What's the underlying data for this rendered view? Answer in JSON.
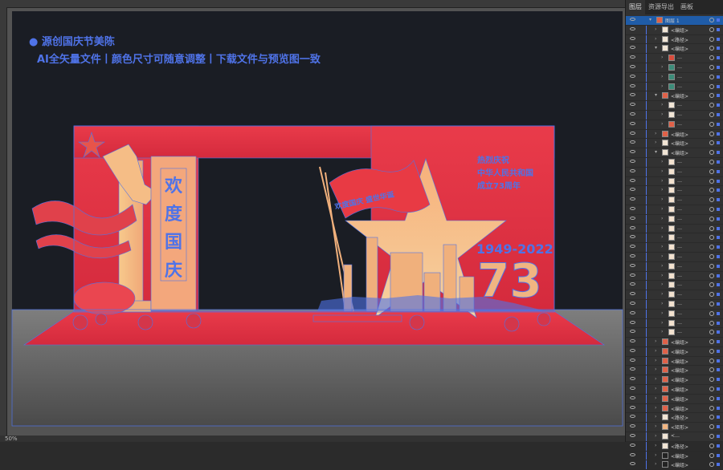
{
  "panel": {
    "tabs": [
      "图层",
      "资源导出",
      "画板"
    ],
    "top_layer": "图层 1",
    "rows": [
      {
        "indent": 1,
        "label": "<编组>",
        "thumb": "#f1e5d5"
      },
      {
        "indent": 1,
        "label": "<路径>",
        "thumb": "#f1e5d5"
      },
      {
        "indent": 1,
        "label": "<编组>",
        "thumb": "#f1e5d5",
        "open": true
      },
      {
        "indent": 2,
        "label": "…",
        "thumb": "#d94c3c"
      },
      {
        "indent": 2,
        "label": "…",
        "thumb": "#3c8c79"
      },
      {
        "indent": 2,
        "label": "…",
        "thumb": "#3c8c79"
      },
      {
        "indent": 2,
        "label": "…",
        "thumb": "#3c8c79"
      },
      {
        "indent": 1,
        "label": "<编组>",
        "thumb": "#e06148",
        "open": true
      },
      {
        "indent": 2,
        "label": "…",
        "thumb": "#f1e5d5"
      },
      {
        "indent": 2,
        "label": "…",
        "thumb": "#f1e5d5"
      },
      {
        "indent": 2,
        "label": "…",
        "thumb": "#e06148"
      },
      {
        "indent": 1,
        "label": "<编组>",
        "thumb": "#e06148"
      },
      {
        "indent": 1,
        "label": "<编组>",
        "thumb": "#f1e5d5"
      },
      {
        "indent": 1,
        "label": "<编组>",
        "thumb": "#f1e5d5",
        "open": true
      },
      {
        "indent": 2,
        "label": "…",
        "thumb": "#f3e2cf"
      },
      {
        "indent": 2,
        "label": "…",
        "thumb": "#f3e2cf"
      },
      {
        "indent": 2,
        "label": "…",
        "thumb": "#f3e2cf"
      },
      {
        "indent": 2,
        "label": "…",
        "thumb": "#f3e2cf"
      },
      {
        "indent": 2,
        "label": "…",
        "thumb": "#f3e2cf"
      },
      {
        "indent": 2,
        "label": "…",
        "thumb": "#f3e2cf"
      },
      {
        "indent": 2,
        "label": "…",
        "thumb": "#f3e2cf"
      },
      {
        "indent": 2,
        "label": "…",
        "thumb": "#f3e2cf"
      },
      {
        "indent": 2,
        "label": "…",
        "thumb": "#f3e2cf"
      },
      {
        "indent": 2,
        "label": "…",
        "thumb": "#f3e2cf"
      },
      {
        "indent": 2,
        "label": "…",
        "thumb": "#f3e2cf"
      },
      {
        "indent": 2,
        "label": "…",
        "thumb": "#f3e2cf"
      },
      {
        "indent": 2,
        "label": "…",
        "thumb": "#f3e2cf"
      },
      {
        "indent": 2,
        "label": "…",
        "thumb": "#f3e2cf"
      },
      {
        "indent": 2,
        "label": "…",
        "thumb": "#f3e2cf"
      },
      {
        "indent": 2,
        "label": "…",
        "thumb": "#f3e2cf"
      },
      {
        "indent": 2,
        "label": "…",
        "thumb": "#f3e2cf"
      },
      {
        "indent": 2,
        "label": "…",
        "thumb": "#f3e2cf"
      },
      {
        "indent": 2,
        "label": "…",
        "thumb": "#f3e2cf"
      },
      {
        "indent": 1,
        "label": "<编组>",
        "thumb": "#e06148"
      },
      {
        "indent": 1,
        "label": "<编组>",
        "thumb": "#e06148"
      },
      {
        "indent": 1,
        "label": "<编组>",
        "thumb": "#e06148"
      },
      {
        "indent": 1,
        "label": "<编组>",
        "thumb": "#e06148"
      },
      {
        "indent": 1,
        "label": "<编组>",
        "thumb": "#e06148"
      },
      {
        "indent": 1,
        "label": "<编组>",
        "thumb": "#e06148"
      },
      {
        "indent": 1,
        "label": "<编组>",
        "thumb": "#e06148"
      },
      {
        "indent": 1,
        "label": "<编组>",
        "thumb": "#e06148"
      },
      {
        "indent": 1,
        "label": "<路径>",
        "thumb": "#f1e5d5"
      },
      {
        "indent": 1,
        "label": "<矩形>",
        "thumb": "#f1b581"
      },
      {
        "indent": 1,
        "label": "<…",
        "thumb": "#f1e5d5"
      },
      {
        "indent": 1,
        "label": "<路径>",
        "thumb": "#f1e5d5"
      },
      {
        "indent": 1,
        "label": "<编组>",
        "thumb": "#222222"
      },
      {
        "indent": 1,
        "label": "<编组>",
        "thumb": "#222222"
      }
    ]
  },
  "canvas": {
    "note_line1": "● 源创国庆节美陈",
    "note_line2": "AI全矢量文件丨颜色尺寸可随意调整丨下载文件与预览图一致",
    "vertical_chars": [
      "欢",
      "度",
      "国",
      "庆"
    ],
    "red_text": [
      "热烈庆祝",
      "中华人民共和国",
      "成立73周年"
    ],
    "years": "1949-2022",
    "big_num": "73",
    "banner_text": "欢度国庆 盛世华诞"
  },
  "statusbar": {
    "zoom": "50%"
  }
}
